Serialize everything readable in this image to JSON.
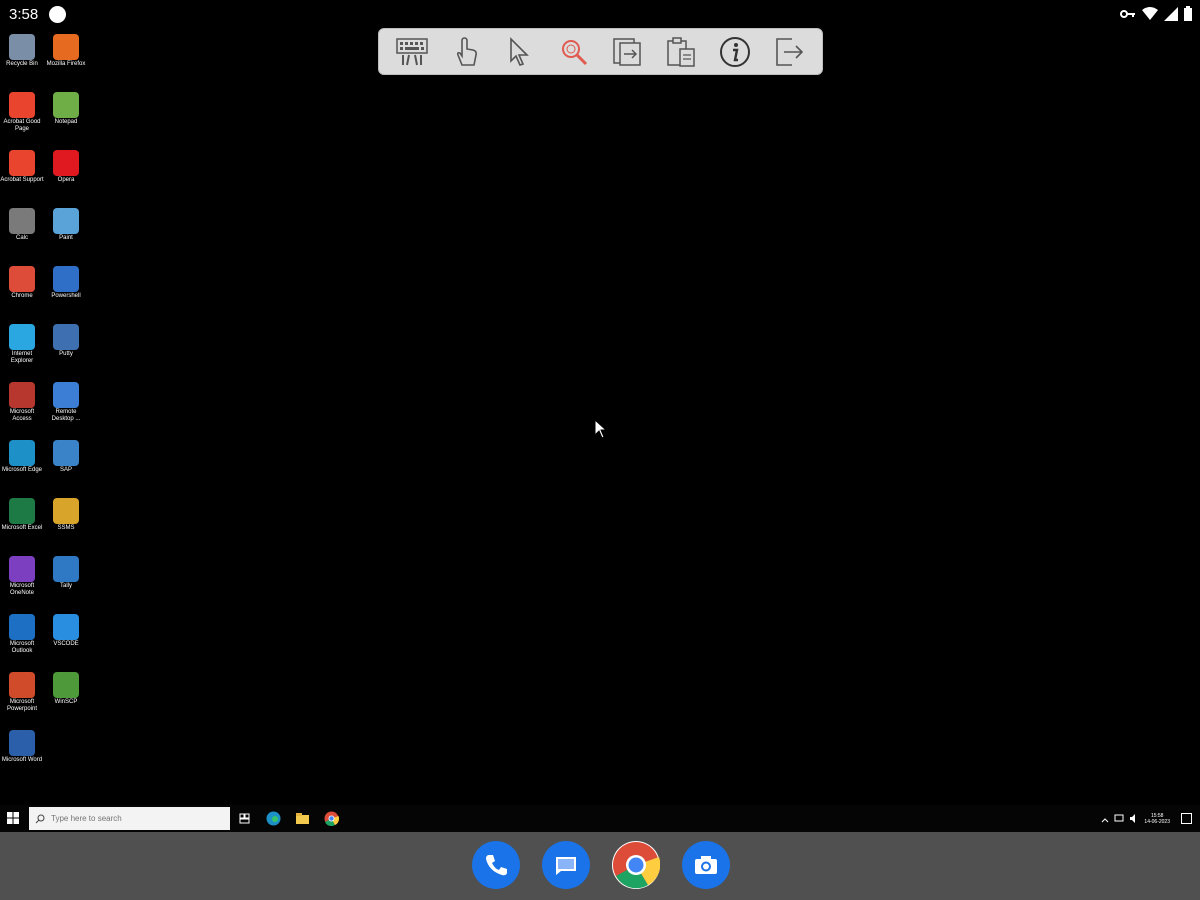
{
  "status_bar": {
    "time": "3:58",
    "icons": [
      "notification-dot-icon",
      "vpn-key-icon",
      "wifi-icon",
      "cell-signal-icon",
      "battery-icon"
    ]
  },
  "toolbar": {
    "buttons": [
      {
        "name": "keyboard",
        "icon": "keyboard-icon"
      },
      {
        "name": "touch",
        "icon": "hand-pointer-icon"
      },
      {
        "name": "mouse",
        "icon": "cursor-arrow-icon"
      },
      {
        "name": "zoom",
        "icon": "magnifier-icon",
        "color": "#e05a4f"
      },
      {
        "name": "special-keys",
        "icon": "ctrl-alt-del-icon"
      },
      {
        "name": "clipboard",
        "icon": "clipboard-icon"
      },
      {
        "name": "info",
        "icon": "info-icon"
      },
      {
        "name": "exit",
        "icon": "exit-icon"
      }
    ]
  },
  "desktop": {
    "icons": [
      {
        "label": "Recycle Bin",
        "icon": "recycle-bin-icon",
        "color": "#7a8ea8"
      },
      {
        "label": "Mozilla Firefox",
        "icon": "firefox-icon",
        "color": "#e66a1f"
      },
      {
        "label": "Acrobat Good Page",
        "icon": "acrobat-icon",
        "color": "#e8442e"
      },
      {
        "label": "Notepad",
        "icon": "notepad-icon",
        "color": "#6fae46"
      },
      {
        "label": "Acrobat Support",
        "icon": "acrobat-icon",
        "color": "#e8442e"
      },
      {
        "label": "Opera",
        "icon": "opera-icon",
        "color": "#e0181f"
      },
      {
        "label": "Calc",
        "icon": "calculator-icon",
        "color": "#7a7a7a"
      },
      {
        "label": "Paint",
        "icon": "paint-icon",
        "color": "#5aa3d8"
      },
      {
        "label": "Chrome",
        "icon": "chrome-icon",
        "color": "#dd4b39"
      },
      {
        "label": "Powershell",
        "icon": "powershell-icon",
        "color": "#2f6fc8"
      },
      {
        "label": "Internet Explorer",
        "icon": "internet-explorer-icon",
        "color": "#2aa6e0"
      },
      {
        "label": "Putty",
        "icon": "putty-icon",
        "color": "#3e6fb0"
      },
      {
        "label": "Microsoft Access",
        "icon": "access-icon",
        "color": "#b7362d"
      },
      {
        "label": "Remote Desktop ...",
        "icon": "remote-desktop-icon",
        "color": "#3c7ed6"
      },
      {
        "label": "Microsoft Edge",
        "icon": "edge-icon",
        "color": "#1e90c8"
      },
      {
        "label": "SAP",
        "icon": "sap-icon",
        "color": "#3a83c9"
      },
      {
        "label": "Microsoft Excel",
        "icon": "excel-icon",
        "color": "#1e7a44"
      },
      {
        "label": "SSMS",
        "icon": "ssms-icon",
        "color": "#d8a52a"
      },
      {
        "label": "Microsoft OneNote",
        "icon": "onenote-icon",
        "color": "#7b3fbf"
      },
      {
        "label": "Tally",
        "icon": "tally-icon",
        "color": "#2f78c4"
      },
      {
        "label": "Microsoft Outlook",
        "icon": "outlook-icon",
        "color": "#1c6fc2"
      },
      {
        "label": "VSCODE",
        "icon": "vscode-icon",
        "color": "#2a8ee0"
      },
      {
        "label": "Microsoft Powerpoint",
        "icon": "powerpoint-icon",
        "color": "#d04b2a"
      },
      {
        "label": "WinSCP",
        "icon": "winscp-icon",
        "color": "#4e9a3a"
      },
      {
        "label": "Microsoft Word",
        "icon": "word-icon",
        "color": "#2b5faa"
      }
    ]
  },
  "taskbar": {
    "search_placeholder": "Type here to search",
    "pinned": [
      "task-view-icon",
      "edge-icon",
      "file-explorer-icon",
      "chrome-icon"
    ],
    "clock_time": "15:58",
    "clock_date": "14-06-2023"
  },
  "dock": {
    "apps": [
      {
        "name": "phone",
        "icon": "phone-icon",
        "color": "#1a73e8"
      },
      {
        "name": "messages",
        "icon": "messages-icon",
        "color": "#1a73e8"
      },
      {
        "name": "chrome",
        "icon": "chrome-icon",
        "color": "#dd4b39"
      },
      {
        "name": "camera",
        "icon": "camera-icon",
        "color": "#1a73e8"
      }
    ]
  }
}
